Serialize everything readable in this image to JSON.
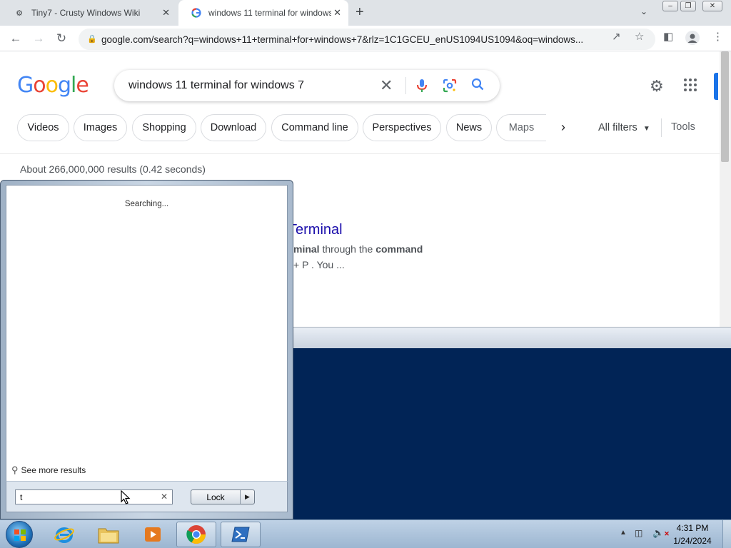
{
  "browser": {
    "tabs": [
      {
        "title": "Tiny7 - Crusty Windows Wiki",
        "active": false
      },
      {
        "title": "windows 11 terminal for windows 7",
        "active": true
      }
    ],
    "url": "google.com/search?q=windows+11+terminal+for+windows+7&rlz=1C1GCEU_enUS1094US1094&oq=windows..."
  },
  "google": {
    "logo": "Google",
    "query": "windows 11 terminal for windows 7",
    "chips": [
      "Videos",
      "Images",
      "Shopping",
      "Download",
      "Command line",
      "Perspectives",
      "News",
      "Maps"
    ],
    "all_filters": "All filters",
    "tools": "Tools",
    "stats": "About 266,000,000 results (0.42 seconds)",
    "result": {
      "title": "Terminal",
      "line1_bold1": "minal",
      "line1_mid": " through the ",
      "line1_bold2": "command",
      "line2": "+ P . You ..."
    }
  },
  "start_menu": {
    "status": "Searching...",
    "see_more": "See more results",
    "search_value": "t",
    "lock_label": "Lock"
  },
  "taskbar": {
    "time": "4:31 PM",
    "date": "1/24/2024"
  },
  "colors": {
    "link_blue": "#1a0dab",
    "console_bg": "#012456",
    "accent": "#1a73e8"
  }
}
